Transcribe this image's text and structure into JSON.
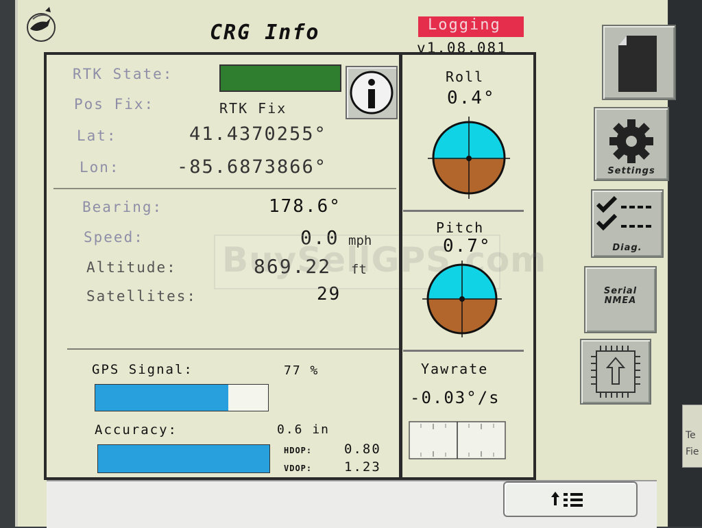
{
  "header": {
    "title": "CRG Info",
    "logging_label": "Logging",
    "version": "v1.08.081"
  },
  "position": {
    "rtk_state_label": "RTK State:",
    "pos_fix_label": "Pos Fix:",
    "pos_fix_value": "RTK Fix",
    "lat_label": "Lat:",
    "lat_value": "41.4370255°",
    "lon_label": "Lon:",
    "lon_value": "-85.6873866°",
    "rtk_state_color": "#2f7d2f"
  },
  "motion": {
    "bearing_label": "Bearing:",
    "bearing_value": "178.6°",
    "speed_label": "Speed:",
    "speed_value": "0.0",
    "speed_unit": "mph",
    "altitude_label": "Altitude:",
    "altitude_value": "869.22",
    "altitude_unit": "ft",
    "satellites_label": "Satellites:",
    "satellites_value": "29"
  },
  "signal": {
    "gps_signal_label": "GPS Signal:",
    "gps_signal_value": "77 %",
    "gps_signal_fraction": 0.77,
    "accuracy_label": "Accuracy:",
    "accuracy_value": "0.6 in",
    "accuracy_fraction": 1.0,
    "hdop_label": "HDOP:",
    "hdop_value": "0.80",
    "vdop_label": "VDOP:",
    "vdop_value": "1.23"
  },
  "attitude": {
    "roll_label": "Roll",
    "roll_value": "0.4°",
    "pitch_label": "Pitch",
    "pitch_value": "0.7°",
    "yawrate_label": "Yawrate",
    "yawrate_value": "-0.03°/s",
    "sky_color": "#10d4e6",
    "ground_color": "#b2662c"
  },
  "sidebar": {
    "items": [
      {
        "label": "",
        "icon": "document-icon"
      },
      {
        "label": "Settings",
        "icon": "gear-icon"
      },
      {
        "label": "Diag.",
        "icon": "checklist-icon"
      },
      {
        "label": "Serial\nNMEA",
        "icon": ""
      },
      {
        "label": "",
        "icon": "upload-chip-icon"
      }
    ]
  },
  "footer": {
    "nav_icon": "arrow-up-list-icon"
  },
  "watermark": "BuySellGPS.com",
  "edge": {
    "partial_label_1": "Te",
    "partial_label_2": "Fie"
  }
}
